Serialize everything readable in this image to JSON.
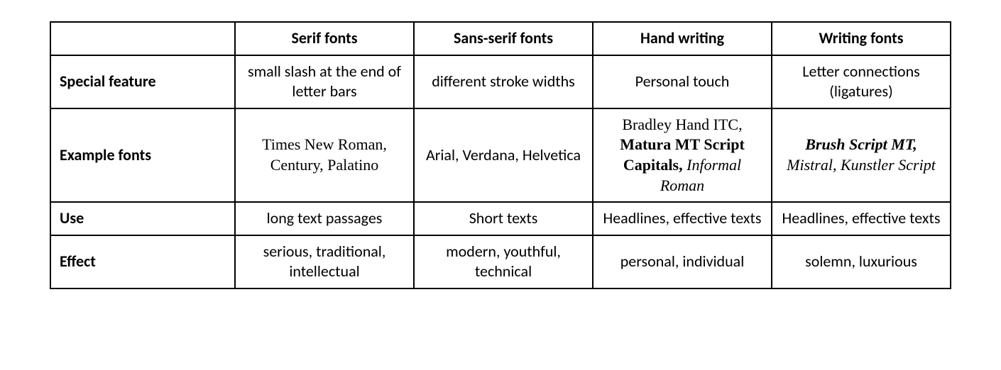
{
  "table": {
    "corner": "",
    "columns": [
      "Serif fonts",
      "Sans-serif fonts",
      "Hand writing",
      "Writing fonts"
    ],
    "rows": [
      {
        "label": "Special feature",
        "cells": [
          "small slash at the end of letter bars",
          "different stroke widths",
          "Personal touch",
          "Letter connections (ligatures)"
        ]
      },
      {
        "label": "Example fonts",
        "cells_examples": [
          [
            "Times New Roman",
            "Century",
            "Palatino"
          ],
          [
            "Arial",
            "Verdana",
            "Helvetica"
          ],
          [
            "Bradley Hand ITC",
            "Matura MT Script Capitals",
            "Informal Roman"
          ],
          [
            "Brush Script MT",
            "Mistral",
            "Kunstler Script"
          ]
        ]
      },
      {
        "label": "Use",
        "cells": [
          "long text passages",
          "Short texts",
          "Headlines, effective texts",
          "Headlines, effective texts"
        ]
      },
      {
        "label": "Effect",
        "cells": [
          "serious, traditional, intellectual",
          "modern, youthful, technical",
          "personal, individual",
          "solemn, luxurious"
        ]
      }
    ]
  }
}
